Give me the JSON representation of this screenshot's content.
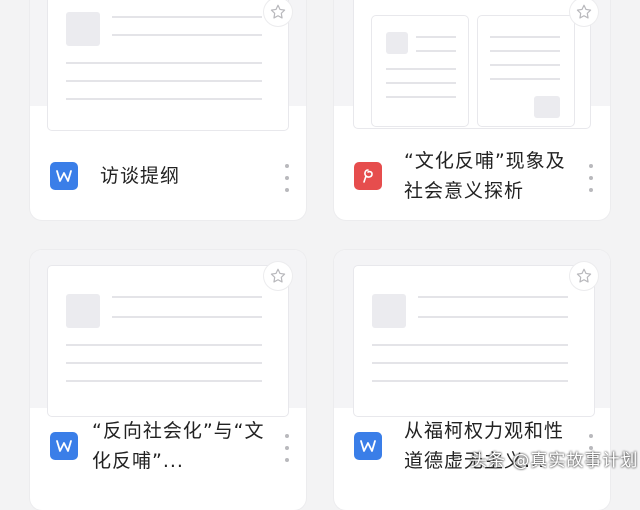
{
  "files": [
    {
      "name": "访谈提纲",
      "type": "word"
    },
    {
      "name": "“文化反哺”现象及社会意义探析",
      "type": "pdf"
    },
    {
      "name": "“反向社会化”与“文化反哺”...",
      "type": "word"
    },
    {
      "name": "从福柯权力观和性道德虚无主义...",
      "type": "word"
    }
  ],
  "icons": {
    "star": "star-outline-icon",
    "more": "more-vertical-icon",
    "word": "word-doc-icon",
    "pdf": "pdf-doc-icon"
  },
  "colors": {
    "word": "#3a7ee8",
    "pdf": "#e64d4d"
  },
  "watermark": "头条 @真实故事计划"
}
